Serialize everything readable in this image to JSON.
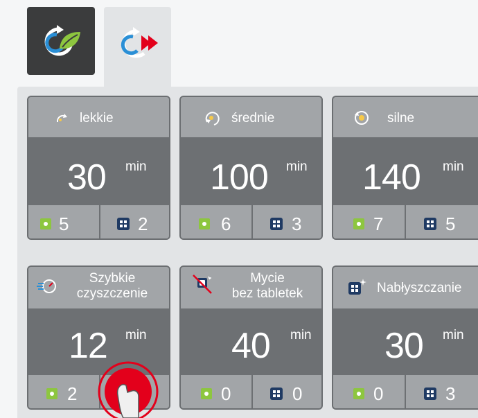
{
  "tabs": [
    {
      "name": "eco",
      "icon": "eco-cycle-icon"
    },
    {
      "name": "quick",
      "icon": "fast-cycle-icon",
      "active": true
    }
  ],
  "programs": [
    {
      "label": "lekkie",
      "duration": "30",
      "unit": "min",
      "salt": "5",
      "rinse": "2",
      "icon": "light-wash-icon"
    },
    {
      "label": "średnie",
      "duration": "100",
      "unit": "min",
      "salt": "6",
      "rinse": "3",
      "icon": "medium-wash-icon"
    },
    {
      "label": "silne",
      "duration": "140",
      "unit": "min",
      "salt": "7",
      "rinse": "5",
      "icon": "intensive-wash-icon"
    },
    {
      "label_line1": "Szybkie",
      "label_line2": "czyszczenie",
      "duration": "12",
      "unit": "min",
      "salt": "2",
      "rinse": "",
      "icon": "quick-clean-icon"
    },
    {
      "label_line1": "Mycie",
      "label_line2": "bez tabletek",
      "duration": "40",
      "unit": "min",
      "salt": "0",
      "rinse": "0",
      "icon": "no-tablet-icon"
    },
    {
      "label": "Nabłyszczanie",
      "duration": "30",
      "unit": "min",
      "salt": "0",
      "rinse": "3",
      "icon": "rinse-aid-icon"
    }
  ],
  "colors": {
    "accent_red": "#e3001b",
    "salt_green": "#8dc63f",
    "rinse_blue": "#1f3a63",
    "eco_leaf": "#8dc63f"
  }
}
